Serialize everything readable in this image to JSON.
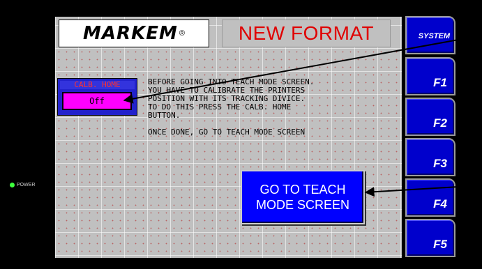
{
  "panel": {
    "logo": "MARKEM",
    "logo_mark": "®",
    "title": "NEW FORMAT",
    "power_label": "POWER"
  },
  "calibration": {
    "label": "CALB. HOME",
    "button_state": "Off"
  },
  "instructions": {
    "lines": [
      "BEFORE GOING INTO TEACH MODE SCREEN.",
      "YOU HAVE TO CALIBRATE THE PRINTERS",
      "POSITION WITH ITS TRACKING DIVICE.",
      "TO DO THIS PRESS THE CALB. HOME",
      "BUTTON.",
      "",
      "ONCE DONE, GO TO TEACH MODE SCREEN"
    ]
  },
  "teach_button": {
    "label": "GO TO TEACH\nMODE SCREEN"
  },
  "function_keys": [
    {
      "label": "SYSTEM"
    },
    {
      "label": "F1"
    },
    {
      "label": "F2"
    },
    {
      "label": "F3"
    },
    {
      "label": "F4"
    },
    {
      "label": "F5"
    }
  ],
  "colors": {
    "title_red": "#e00000",
    "key_blue": "#0000cc",
    "calb_magenta": "#ff00ff",
    "power_led": "#3dff3d"
  }
}
